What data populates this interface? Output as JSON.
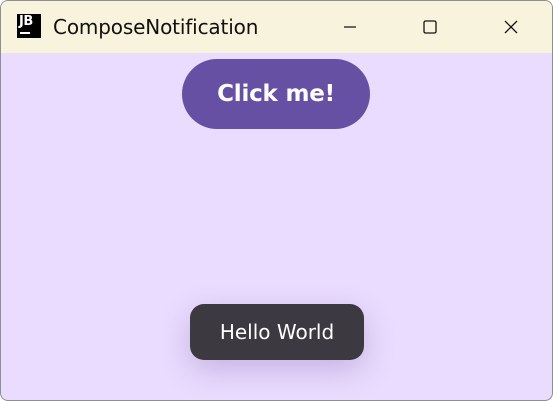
{
  "window": {
    "title": "ComposeNotification",
    "app_icon_text": "JB",
    "app_icon": "jetbrains-logo-icon",
    "controls": {
      "minimize_icon": "minimize-icon",
      "maximize_icon": "maximize-icon",
      "close_icon": "close-icon"
    }
  },
  "main": {
    "button_label": "Click me!",
    "toast_text": "Hello World"
  },
  "colors": {
    "titlebar_bg": "#f8f3dc",
    "content_bg": "#eadcff",
    "button_bg": "#6650a4",
    "toast_bg": "#3c3940"
  }
}
